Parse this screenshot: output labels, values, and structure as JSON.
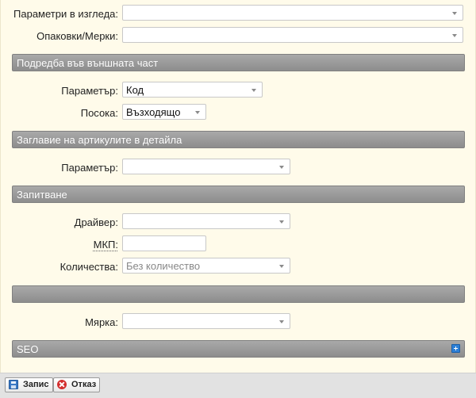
{
  "form": {
    "view_params": {
      "label": "Параметри в изгледа:",
      "value": ""
    },
    "packaging": {
      "label": "Опаковки/Мерки:",
      "value": ""
    }
  },
  "section_outer_sort": {
    "title": "Подредба във външната част",
    "param": {
      "label": "Параметър:",
      "value": "Код"
    },
    "direction": {
      "label": "Посока:",
      "value": "Възходящо"
    }
  },
  "section_detail_title": {
    "title": "Заглавие на артикулите в детайла",
    "param": {
      "label": "Параметър:",
      "value": ""
    }
  },
  "section_inquiry": {
    "title": "Запитване",
    "driver": {
      "label": "Драйвер:",
      "value": ""
    },
    "mkp": {
      "label": "МКП:",
      "value": ""
    },
    "quantities": {
      "label": "Количества:",
      "value": "Без количество"
    }
  },
  "section_blank": {
    "title": "",
    "measure": {
      "label": "Мярка:",
      "value": ""
    }
  },
  "section_seo": {
    "title": "SEO",
    "expand_icon": "plus-icon"
  },
  "toolbar": {
    "save_label": "Запис",
    "cancel_label": "Отказ",
    "save_icon": "save-icon",
    "cancel_icon": "cancel-icon"
  },
  "colors": {
    "background": "#fffbea",
    "section_bar": "#999999",
    "toolbar": "#e2e2e2",
    "plus_icon": "#2c7fd6",
    "cancel_icon": "#d32f2f"
  }
}
